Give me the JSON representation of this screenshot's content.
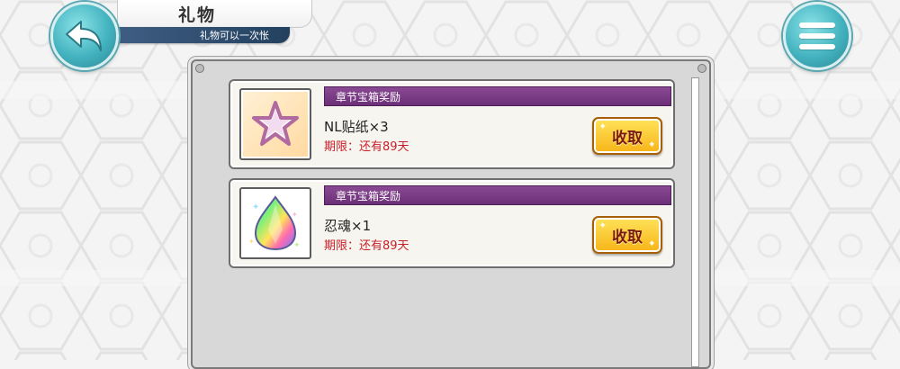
{
  "header": {
    "title": "礼物",
    "subtitle": "礼物可以一次怅"
  },
  "icons": {
    "back": "back-arrow-icon",
    "menu": "hamburger-menu-icon"
  },
  "rewards": [
    {
      "category": "章节宝箱奖励",
      "name": "NL贴纸×3",
      "expire": "期限：还有89天",
      "claim_label": "收取",
      "icon": "star-sticker-icon"
    },
    {
      "category": "章节宝箱奖励",
      "name": "忍魂×1",
      "expire": "期限：还有89天",
      "claim_label": "收取",
      "icon": "rainbow-gem-icon"
    }
  ],
  "colors": {
    "header_purple": "#6b2f78",
    "expire_red": "#c8202a",
    "claim_yellow": "#f7b418",
    "teal_button": "#43b3bf"
  }
}
